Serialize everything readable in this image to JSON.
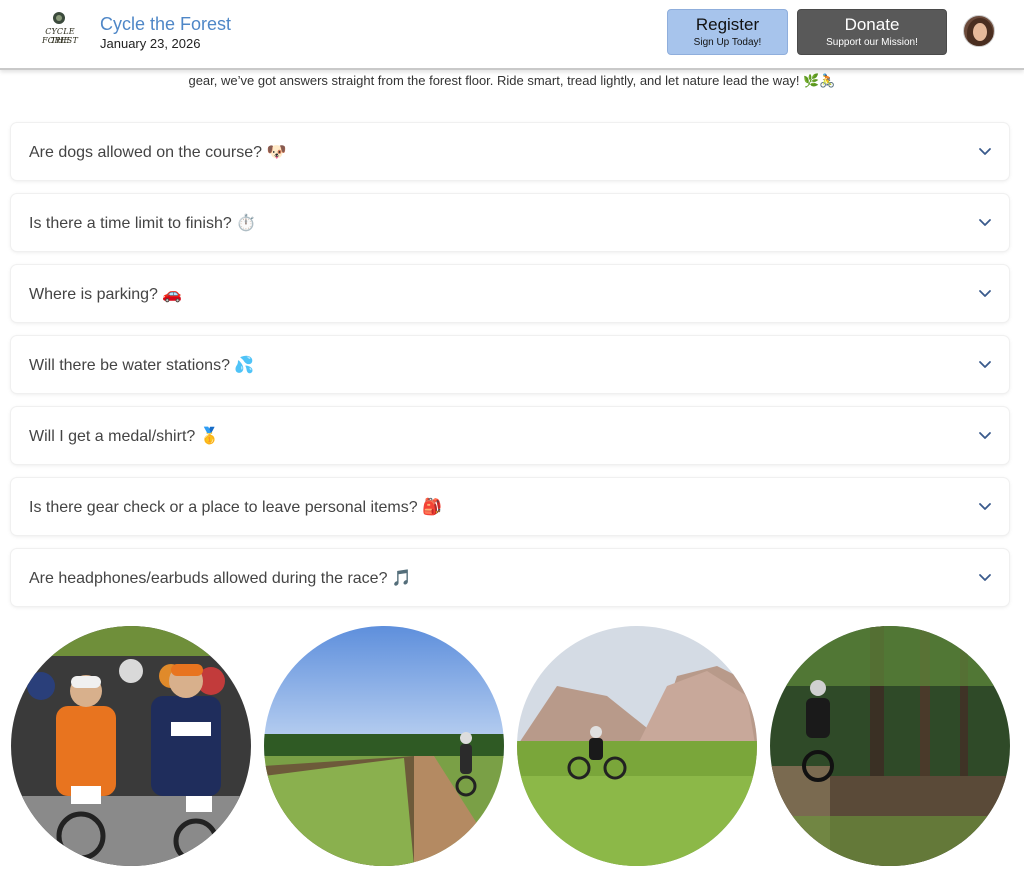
{
  "header": {
    "logo": {
      "line1": "CYCLE THE",
      "line2": "FOREST"
    },
    "title": "Cycle the Forest",
    "date": "January 23, 2026",
    "register": {
      "label": "Register",
      "sub": "Sign Up Today!"
    },
    "donate": {
      "label": "Donate",
      "sub": "Support our Mission!"
    },
    "avatar_icon": "user-avatar"
  },
  "intro_text": "gear, we’ve got answers straight from the forest floor. Ride smart, tread lightly, and let nature lead the way! 🌿🚴",
  "faq": [
    {
      "question": "Are dogs allowed on the course? 🐶"
    },
    {
      "question": "Is there a time limit to finish? ⏱️"
    },
    {
      "question": "Where is parking? 🚗"
    },
    {
      "question": "Will there be water stations? 💦"
    },
    {
      "question": "Will I get a medal/shirt? 🥇"
    },
    {
      "question": "Is there gear check or a place to leave personal items? 🎒"
    },
    {
      "question": "Are headphones/earbuds allowed during the race? 🎵"
    }
  ],
  "chevron_icon": "chevron-down-icon",
  "colors": {
    "brand": "#4f87c7",
    "register_bg": "#a7c4ec",
    "donate_bg": "#595959",
    "chevron": "#3a5a8c"
  },
  "photos": [
    {
      "name": "riders-at-start-line"
    },
    {
      "name": "rider-on-dirt-road"
    },
    {
      "name": "rider-on-mountain-meadow"
    },
    {
      "name": "rider-on-forest-trail"
    }
  ]
}
